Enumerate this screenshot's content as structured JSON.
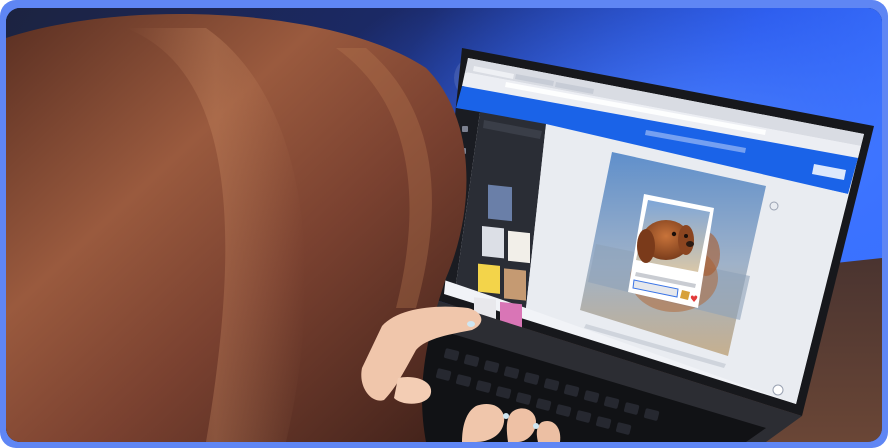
{
  "scene": {
    "frame_color": "#5f86f4",
    "backdrop_glow_color": "#2f63ff",
    "hair_color": "#8a4e37",
    "screen_accent_color": "#1a63e8",
    "desk_color": "#5a3b2e"
  },
  "laptop_screen": {
    "browser_tab_count": 3,
    "sidebar_thumbnail_count": 8,
    "text_legible": false
  },
  "design_card": {
    "subject": "dog portrait",
    "heart_color": "#e23a3a",
    "sky_top": "#6b95cc",
    "sky_bottom": "#c9b99e"
  },
  "icons": [
    "heart-icon",
    "zoom-icon",
    "help-icon"
  ]
}
